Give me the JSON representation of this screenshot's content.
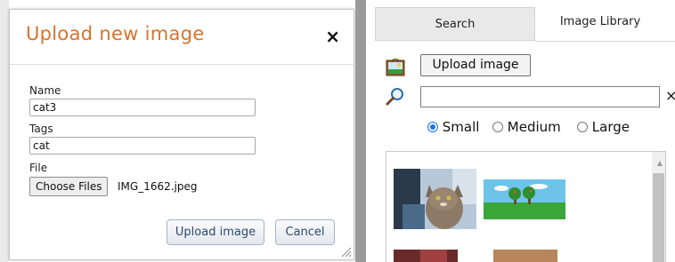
{
  "modal": {
    "title": "Upload new image",
    "close_glyph": "×",
    "name_label": "Name",
    "name_value": "cat3",
    "tags_label": "Tags",
    "tags_value": "cat",
    "file_label": "File",
    "choose_files_label": "Choose Files",
    "file_name": "IMG_1662.jpeg",
    "upload_label": "Upload image",
    "cancel_label": "Cancel"
  },
  "panel": {
    "tabs": [
      {
        "label": "Search"
      },
      {
        "label": "Image Library"
      }
    ],
    "upload_label": "Upload image",
    "search_value": "",
    "clear_glyph": "×",
    "sizes": [
      {
        "label": "Small",
        "selected": true
      },
      {
        "label": "Medium",
        "selected": false
      },
      {
        "label": "Large",
        "selected": false
      }
    ],
    "gallery": [
      {
        "name": "cat-photo"
      },
      {
        "name": "trees-landscape"
      },
      {
        "name": "dark-red-photo"
      },
      {
        "name": "tan-photo"
      }
    ]
  },
  "colors": {
    "title_orange": "#d9722a",
    "radio_blue": "#1a73e8",
    "button_text": "#2d4a6e"
  }
}
